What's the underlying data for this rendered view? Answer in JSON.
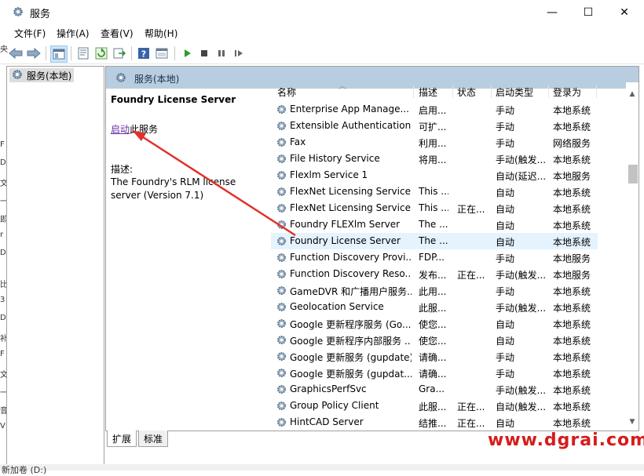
{
  "window": {
    "title": "服务",
    "controls": {
      "minimize": "—",
      "maximize": "☐",
      "close": "✕"
    }
  },
  "menu": [
    "文件(F)",
    "操作(A)",
    "查看(V)",
    "帮助(H)"
  ],
  "toolbar": {
    "icons": [
      "back-icon",
      "forward-icon",
      "show-hide-tree-icon",
      "properties-icon",
      "refresh-icon",
      "export-list-icon",
      "help-icon",
      "console-view-icon",
      "start-service-icon",
      "stop-service-icon",
      "pause-service-icon",
      "restart-service-icon"
    ]
  },
  "tree": {
    "root_label": "服务(本地)"
  },
  "main": {
    "header_label": "服务(本地)",
    "detail": {
      "service_title": "Foundry License Server",
      "start_link": "启动",
      "start_suffix": "此服务",
      "desc_label": "描述:",
      "desc_text": "The Foundry's RLM license server (Version 7.1)"
    },
    "columns": [
      "名称",
      "描述",
      "状态",
      "启动类型",
      "登录为"
    ],
    "rows": [
      {
        "name": "Enterprise App Manage...",
        "desc": "启用...",
        "status": "",
        "type": "手动",
        "logon": "本地系统"
      },
      {
        "name": "Extensible Authentication...",
        "desc": "可扩...",
        "status": "",
        "type": "手动",
        "logon": "本地系统"
      },
      {
        "name": "Fax",
        "desc": "利用...",
        "status": "",
        "type": "手动",
        "logon": "网络服务"
      },
      {
        "name": "File History Service",
        "desc": "将用...",
        "status": "",
        "type": "手动(触发...",
        "logon": "本地系统"
      },
      {
        "name": "Flexlm Service 1",
        "desc": "",
        "status": "",
        "type": "自动(延迟...",
        "logon": "本地服务"
      },
      {
        "name": "FlexNet Licensing Service",
        "desc": "This ...",
        "status": "",
        "type": "自动",
        "logon": "本地系统"
      },
      {
        "name": "FlexNet Licensing Service...",
        "desc": "This ...",
        "status": "正在...",
        "type": "自动",
        "logon": "本地系统"
      },
      {
        "name": "Foundry FLEXlm Server",
        "desc": "The ...",
        "status": "",
        "type": "自动",
        "logon": "本地系统"
      },
      {
        "name": "Foundry License Server",
        "desc": "The ...",
        "status": "",
        "type": "自动",
        "logon": "本地系统",
        "selected": true
      },
      {
        "name": "Function Discovery Provi...",
        "desc": "FDP...",
        "status": "",
        "type": "手动",
        "logon": "本地服务"
      },
      {
        "name": "Function Discovery Reso...",
        "desc": "发布...",
        "status": "正在...",
        "type": "手动(触发...",
        "logon": "本地服务"
      },
      {
        "name": "GameDVR 和广播用户服务...",
        "desc": "此用...",
        "status": "",
        "type": "手动",
        "logon": "本地系统"
      },
      {
        "name": "Geolocation Service",
        "desc": "此服...",
        "status": "",
        "type": "手动(触发...",
        "logon": "本地系统"
      },
      {
        "name": "Google 更新程序服务 (Go...",
        "desc": "使您...",
        "status": "",
        "type": "自动",
        "logon": "本地系统"
      },
      {
        "name": "Google 更新程序内部服务 ...",
        "desc": "使您...",
        "status": "",
        "type": "自动",
        "logon": "本地系统"
      },
      {
        "name": "Google 更新服务 (gupdate)",
        "desc": "请确...",
        "status": "",
        "type": "手动",
        "logon": "本地系统"
      },
      {
        "name": "Google 更新服务 (gupdat...",
        "desc": "请确...",
        "status": "",
        "type": "手动",
        "logon": "本地系统"
      },
      {
        "name": "GraphicsPerfSvc",
        "desc": "Gra...",
        "status": "",
        "type": "手动(触发...",
        "logon": "本地系统"
      },
      {
        "name": "Group Policy Client",
        "desc": "此服...",
        "status": "正在...",
        "type": "自动(触发...",
        "logon": "本地系统"
      },
      {
        "name": "HintCAD Server",
        "desc": "结推...",
        "status": "正在...",
        "type": "自动",
        "logon": "本地系统"
      }
    ]
  },
  "tabs": [
    "扩展",
    "标准"
  ],
  "watermark": "www.dgrai.com",
  "background_sliver": [
    "央",
    "F",
    "D",
    "文",
    "一",
    "即",
    "r",
    "D",
    "比",
    "3",
    "D",
    "补",
    "F",
    "文",
    "一",
    "音",
    "V"
  ],
  "bottom_cut_text": "新加卷 (D:)",
  "colors": {
    "header_bg": "#b9cde0",
    "selected_row": "#e5f3ff",
    "link": "#6b2fa0",
    "arrow": "#e0312b",
    "watermark": "#d61c1c"
  }
}
